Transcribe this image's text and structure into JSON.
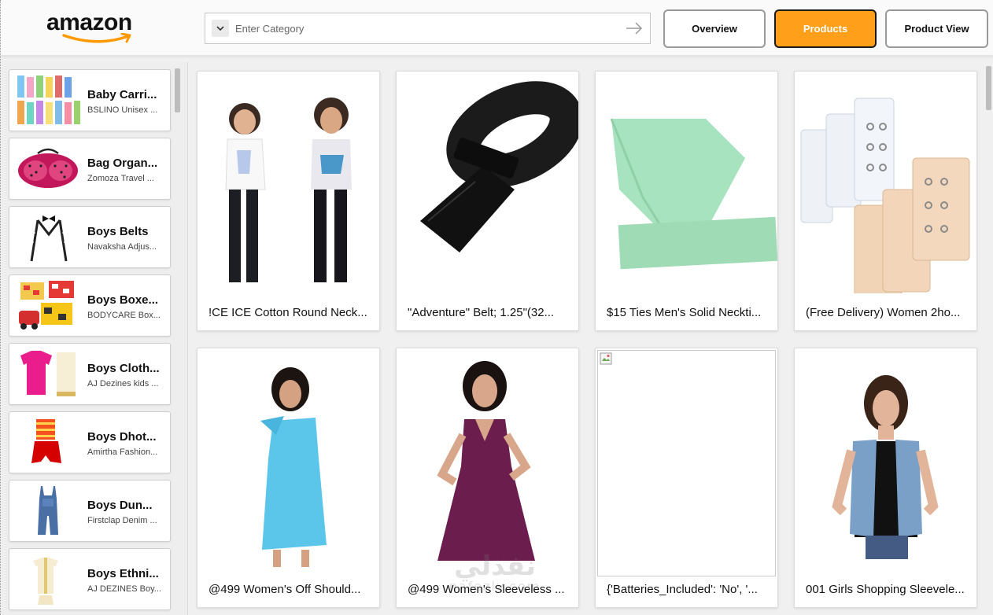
{
  "header": {
    "logo_text": "amazon",
    "search": {
      "placeholder": "Enter Category"
    },
    "nav": {
      "overview": "Overview",
      "products": "Products",
      "product_view": "Product View"
    },
    "accent_color": "#ff9f1a"
  },
  "sidebar": {
    "items": [
      {
        "title": "Baby Carri...",
        "subtitle": "BSLINO Unisex ...",
        "icon": "socks-image"
      },
      {
        "title": "Bag Organ...",
        "subtitle": "Zomoza Travel ...",
        "icon": "pink-dotted-case-image"
      },
      {
        "title": "Boys Belts",
        "subtitle": "Navaksha Adjus...",
        "icon": "suspenders-image"
      },
      {
        "title": "Boys Boxe...",
        "subtitle": "BODYCARE Box...",
        "icon": "boxer-shorts-image"
      },
      {
        "title": "Boys Cloth...",
        "subtitle": "AJ Dezines kids ...",
        "icon": "kids-shirt-image"
      },
      {
        "title": "Boys Dhot...",
        "subtitle": "Amirtha Fashion...",
        "icon": "dhoti-set-image"
      },
      {
        "title": "Boys Dun...",
        "subtitle": "Firstclap Denim ...",
        "icon": "denim-dungaree-image"
      },
      {
        "title": "Boys Ethni...",
        "subtitle": "AJ DEZINES Boy...",
        "icon": "ethnic-wear-image"
      }
    ]
  },
  "products": [
    {
      "title": "!CE ICE Cotton Round Neck...",
      "image": "kids-tshirts-image"
    },
    {
      "title": "\"Adventure\" Belt; 1.25\"(32...",
      "image": "black-belt-image"
    },
    {
      "title": "$15 Ties Men's Solid Neckti...",
      "image": "mint-green-tie-image"
    },
    {
      "title": "(Free Delivery) Women 2ho...",
      "image": "bra-extenders-image"
    },
    {
      "title": "@499 Women's Off Should...",
      "image": "blue-dress-image"
    },
    {
      "title": "@499 Women's Sleeveless ...",
      "image": "purple-dress-image"
    },
    {
      "title": "{'Batteries_Included': 'No', '...",
      "image": "broken-image"
    },
    {
      "title": "001 Girls Shopping Sleevele...",
      "image": "denim-vest-image"
    }
  ],
  "watermark": {
    "line1": "نفذلي",
    "line2": "nafezly.com"
  }
}
